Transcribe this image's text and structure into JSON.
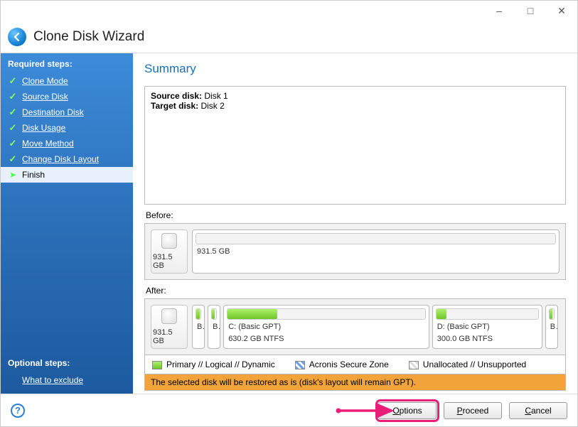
{
  "window": {
    "title": "Clone Disk Wizard"
  },
  "sidebar": {
    "required_heading": "Required steps:",
    "steps": [
      {
        "label": "Clone Mode",
        "state": "done"
      },
      {
        "label": "Source Disk",
        "state": "done"
      },
      {
        "label": "Destination Disk",
        "state": "done"
      },
      {
        "label": "Disk Usage",
        "state": "done"
      },
      {
        "label": "Move Method",
        "state": "done"
      },
      {
        "label": "Change Disk Layout",
        "state": "done"
      },
      {
        "label": "Finish",
        "state": "current"
      }
    ],
    "optional_heading": "Optional steps:",
    "optional_items": [
      "What to exclude"
    ]
  },
  "main": {
    "page_title": "Summary",
    "source_label": "Source disk:",
    "source_value": "Disk 1",
    "target_label": "Target disk:",
    "target_value": "Disk 2",
    "before_label": "Before:",
    "after_label": "After:",
    "before_disk": {
      "total": "931.5 GB",
      "partitions": [
        {
          "name": "",
          "detail": "931.5 GB",
          "fill_pct": 0,
          "width_pct": 100
        }
      ]
    },
    "after_disk": {
      "total": "931.5 GB",
      "partitions": [
        {
          "name": "B...",
          "detail": "",
          "fill_pct": 85,
          "width_pct": 3.5
        },
        {
          "name": "B...",
          "detail": "",
          "fill_pct": 60,
          "width_pct": 3.5
        },
        {
          "name": "C: (Basic GPT)",
          "detail": "630.2 GB  NTFS",
          "fill_pct": 25,
          "width_pct": 56
        },
        {
          "name": "D: (Basic GPT)",
          "detail": "300.0 GB  NTFS",
          "fill_pct": 10,
          "width_pct": 30
        },
        {
          "name": "B...",
          "detail": "",
          "fill_pct": 70,
          "width_pct": 3.5
        }
      ]
    },
    "legend": {
      "primary": "Primary // Logical // Dynamic",
      "zone": "Acronis Secure Zone",
      "unalloc": "Unallocated // Unsupported"
    },
    "restore_msg": "The selected disk will be restored as is (disk's layout will remain GPT)."
  },
  "footer": {
    "options": "Options",
    "proceed": "Proceed",
    "cancel": "Cancel"
  }
}
